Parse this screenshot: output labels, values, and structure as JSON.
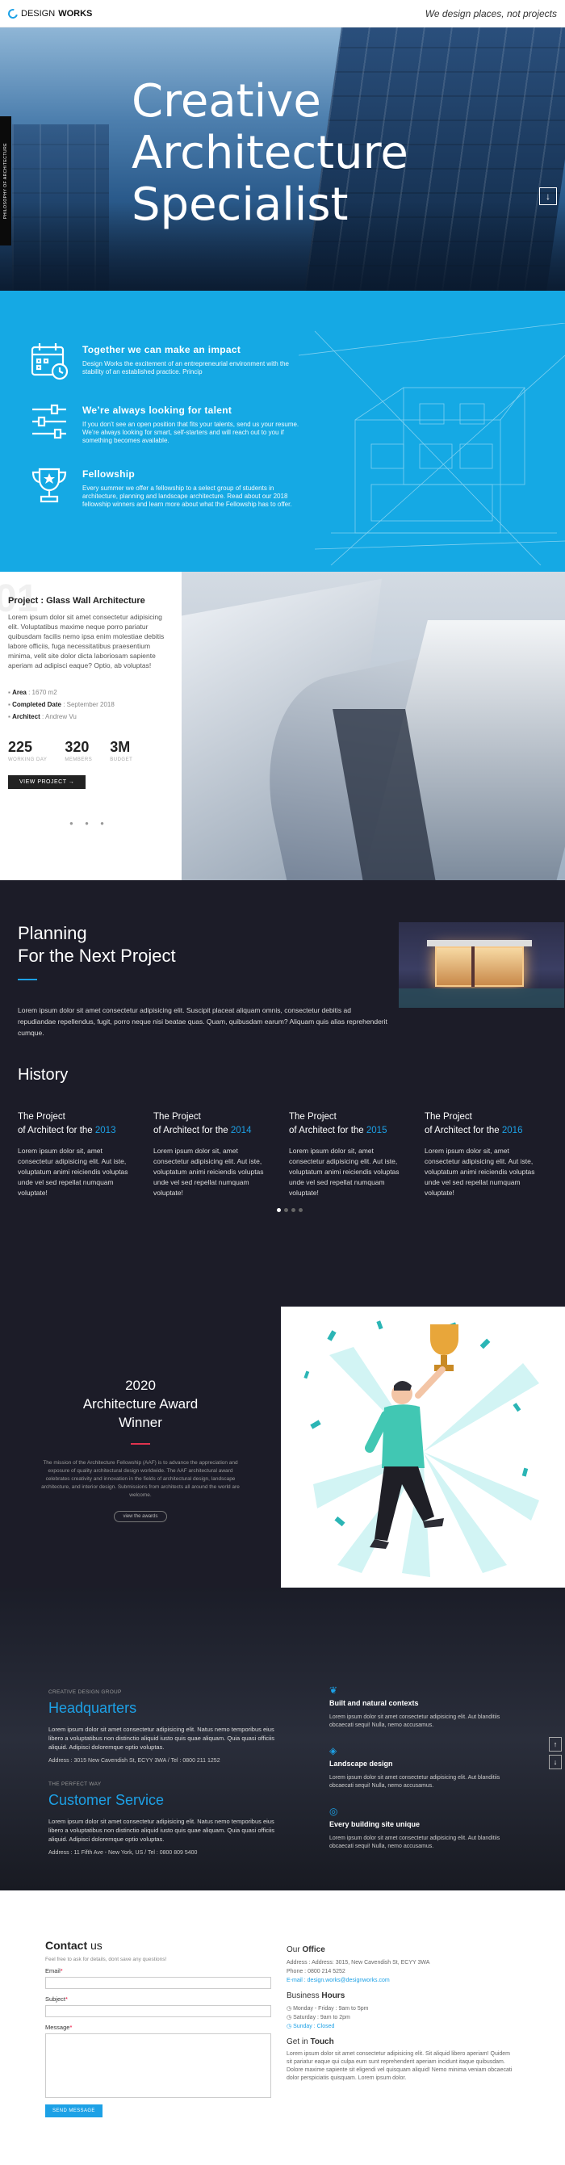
{
  "header": {
    "logo_design": "DESIGN",
    "logo_works": "WORKS",
    "tagline": "We design places, not projects"
  },
  "hero": {
    "title_line1": "Creative",
    "title_line2": "Architecture",
    "title_line3": "Specialist",
    "side_label": "PHILOSOPHY OF ARCHITECTURE",
    "scroll_icon": "arrow-down-box-icon"
  },
  "features": [
    {
      "icon": "calendar-icon",
      "title": "Together we can make an impact",
      "text": "Design Works the excitement of an entrepreneurial environment with the stability of an established practice. Princip"
    },
    {
      "icon": "sliders-icon",
      "title": "We’re always looking for talent",
      "text": "If you don’t see an open position that fits your talents, send us your resume. We’re always looking for smart, self-starters and will reach out to you if something becomes available."
    },
    {
      "icon": "trophy-icon",
      "title": "Fellowship",
      "text": "Every summer we offer a fellowship to a select group of students in architecture, planning and landscape architecture. Read about our 2018 fellowship winners and learn more about what the Fellowship has to offer."
    }
  ],
  "project": {
    "number": "01",
    "title": "Project : Glass Wall Architecture",
    "description": "Lorem ipsum dolor sit amet consectetur adipisicing elit. Voluptatibus maxime neque porro pariatur quibusdam facilis nemo ipsa enim molestiae debitis labore officiis, fuga necessitatibus praesentium minima, velit site dolor dicta laboriosam sapiente aperiam ad adipisci eaque? Optio, ab voluptas!",
    "area_label": "Area",
    "area_value": ": 1670 m2",
    "completed_label": "Completed Date",
    "completed_value": ": September 2018",
    "architect_label": "Architect",
    "architect_value": ": Andrew Vu",
    "stats": [
      {
        "value": "225",
        "label": "WORKING DAY"
      },
      {
        "value": "320",
        "label": "MEMBERS"
      },
      {
        "value": "3M",
        "label": "BUDGET"
      }
    ],
    "view_button": "VIEW PROJECT →",
    "pager": "● ● ●"
  },
  "planning": {
    "title_line1": "Planning",
    "title_line2": "For the Next Project",
    "text": "Lorem ipsum dolor sit amet consectetur adipisicing elit. Suscipit placeat aliquam omnis, consectetur debitis ad repudiandae repellendus, fugit, porro neque nisi beatae quas. Quam, quibusdam earum? Aliquam quis alias reprehenderit cumque."
  },
  "history": {
    "title": "History",
    "items": [
      {
        "line1": "The Project",
        "line2": "of Architect for the",
        "year": "2013",
        "text": "Lorem ipsum dolor sit, amet consectetur adipisicing elit. Aut iste, voluptatum animi reiciendis voluptas unde vel sed repellat numquam voluptate!"
      },
      {
        "line1": "The Project",
        "line2": "of Architect for the",
        "year": "2014",
        "text": "Lorem ipsum dolor sit, amet consectetur adipisicing elit. Aut iste, voluptatum animi reiciendis voluptas unde vel sed repellat numquam voluptate!"
      },
      {
        "line1": "The Project",
        "line2": "of Architect for the",
        "year": "2015",
        "text": "Lorem ipsum dolor sit, amet consectetur adipisicing elit. Aut iste, voluptatum animi reiciendis voluptas unde vel sed repellat numquam voluptate!"
      },
      {
        "line1": "The Project",
        "line2": "of Architect for the",
        "year": "2016",
        "text": "Lorem ipsum dolor sit, amet consectetur adipisicing elit. Aut iste, voluptatum animi reiciendis voluptas unde vel sed repellat numquam voluptate!"
      }
    ]
  },
  "award": {
    "year": "2020",
    "line2": "Architecture Award",
    "line3": "Winner",
    "text": "The mission of the Architecture Fellowship (AAF) is to advance the appreciation and exposure of quality architectural design worldwide. The AAF architectural award celebrates creativity and innovation in the fields of architectural design, landscape architecture, and interior design. Submissions from architects all around the world are welcome.",
    "button": "view the awards"
  },
  "hq": {
    "kicker1": "CREATIVE DESIGN GROUP",
    "title1": "Headquarters",
    "text1": "Lorem ipsum dolor sit amet consectetur adipisicing elit. Natus nemo temporibus eius libero a voluptatibus non distinctio aliquid iusto quis quae aliquam. Quia quasi officiis aliquid. Adipisci doloremque optio voluptas.",
    "addr1": "Address : 3015 New Cavendish St, ECYY 3WA / Tel : 0800 211 1252",
    "kicker2": "THE PERFECT WAY",
    "title2": "Customer Service",
    "text2": "Lorem ipsum dolor sit amet consectetur adipisicing elit. Natus nemo temporibus eius libero a voluptatibus non distinctio aliquid iusto quis quae aliquam. Quia quasi officiis aliquid. Adipisci doloremque optio voluptas.",
    "addr2": "Address : 11 Fifth Ave - New York, US / Tel : 0800 809 5400",
    "items": [
      {
        "icon": "leaf-icon",
        "title": "Built and natural contexts",
        "text": "Lorem ipsum dolor sit amet consectetur adipisicing elit. Aut blanditiis obcaecati sequi! Nulla, nemo accusamus."
      },
      {
        "icon": "cube-icon",
        "title": "Landscape design",
        "text": "Lorem ipsum dolor sit amet consectetur adipisicing elit. Aut blanditiis obcaecati sequi! Nulla, nemo accusamus."
      },
      {
        "icon": "target-icon",
        "title": "Every building site unique",
        "text": "Lorem ipsum dolor sit amet consectetur adipisicing elit. Aut blanditiis obcaecati sequi! Nulla, nemo accusamus."
      }
    ],
    "nav_up": "↑",
    "nav_down": "↓"
  },
  "contact": {
    "title_bold": "Contact",
    "title_rest": "us",
    "subtitle": "Feel free to ask for details, dont save any questions!",
    "email_label": "Email",
    "subject_label": "Subject",
    "message_label": "Message",
    "required_mark": "*",
    "send_button": "SEND MESSAGE",
    "office_title_a": "Our",
    "office_title_b": "Office",
    "office_address": "Address : Address: 3015, New Cavendish St, ECYY 3WA",
    "office_phone": "Phone : 0800 214 5252",
    "office_email": "E-mail : design.works@designworks.com",
    "hours_title_a": "Business",
    "hours_title_b": "Hours",
    "hours_1": "Monday - Friday : 9am to 5pm",
    "hours_2": "Saturday : 9am to 2pm",
    "hours_3": "Sunday : Closed",
    "touch_title_a": "Get in",
    "touch_title_b": "Touch",
    "touch_text": "Lorem ipsum dolor sit amet consectetur adipisicing elit. Sit aliquid libero aperiam! Quidem sit pariatur eaque qui culpa eum sunt reprehenderit aperiam incidunt itaque quibusdam. Dolore maxime sapiente sit eligendi vel quisquam aliquid! Nemo minima veniam obcaecati dolor perspiciatis quisquam. Lorem ipsum dolor."
  },
  "colors": {
    "accent": "#1da1e6",
    "features_bg": "#15a9e4",
    "dark_bg": "#1c1c28",
    "award_bar": "#e0334e"
  }
}
